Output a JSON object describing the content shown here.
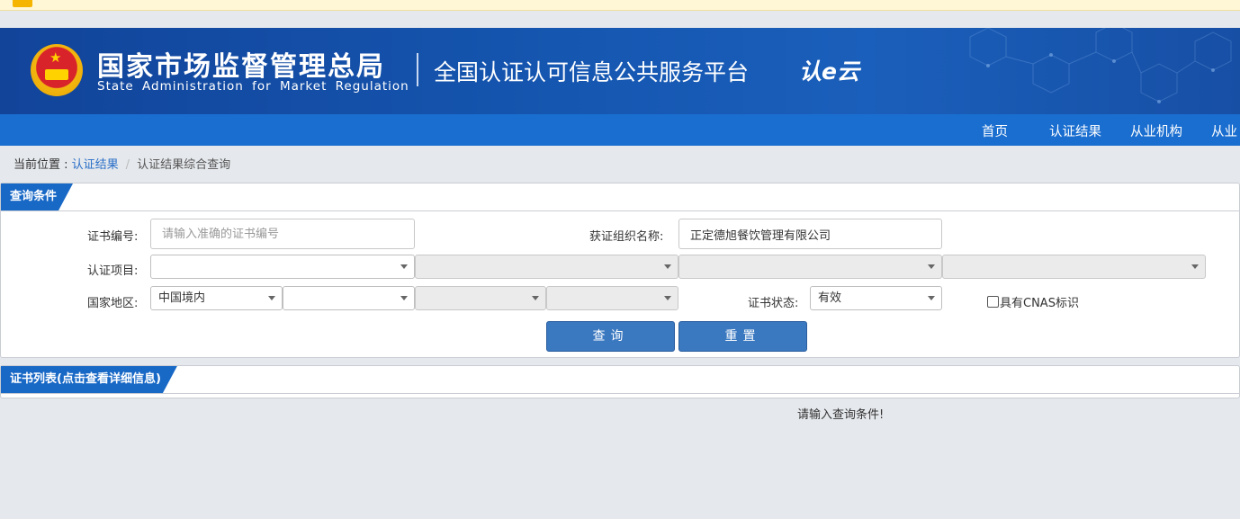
{
  "colors": {
    "header_blue": "#1556b0",
    "nav_blue": "#1a6ed0",
    "tab_blue": "#1868c6",
    "button_blue": "#3a78c0",
    "link_blue": "#2a6fc9",
    "page_bg": "#e5e8ec"
  },
  "header": {
    "org_name_cn": "国家市场监督管理总局",
    "org_name_en": "State Administration  for  Market Regulation",
    "platform_name": "全国认证认可信息公共服务平台",
    "platform_logo": "认e云",
    "emblem_icon": "national-emblem-icon"
  },
  "nav": {
    "items": [
      {
        "label": "首页"
      },
      {
        "label": "认证结果"
      },
      {
        "label": "从业机构"
      },
      {
        "label": "从业"
      }
    ]
  },
  "breadcrumb": {
    "prefix": "当前位置 : ",
    "link": "认证结果",
    "separator": "/",
    "current": "认证结果综合查询"
  },
  "query_panel": {
    "title": "查询条件",
    "cert_no_label": "证书编号:",
    "cert_no_placeholder": "请输入准确的证书编号",
    "cert_no_value": "",
    "org_name_label": "获证组织名称:",
    "org_name_value": "正定德旭餐饮管理有限公司",
    "project_label": "认证项目:",
    "project_selects": [
      "",
      "",
      "",
      ""
    ],
    "region_label": "国家地区:",
    "region_selects": [
      "中国境内",
      "",
      "",
      ""
    ],
    "status_label": "证书状态:",
    "status_value": "有效",
    "cnas_label": "具有CNAS标识",
    "cnas_checked": false,
    "search_button": "查询",
    "reset_button": "重置"
  },
  "list_panel": {
    "title": "证书列表(点击查看详细信息)",
    "empty_message": "请输入查询条件!"
  }
}
